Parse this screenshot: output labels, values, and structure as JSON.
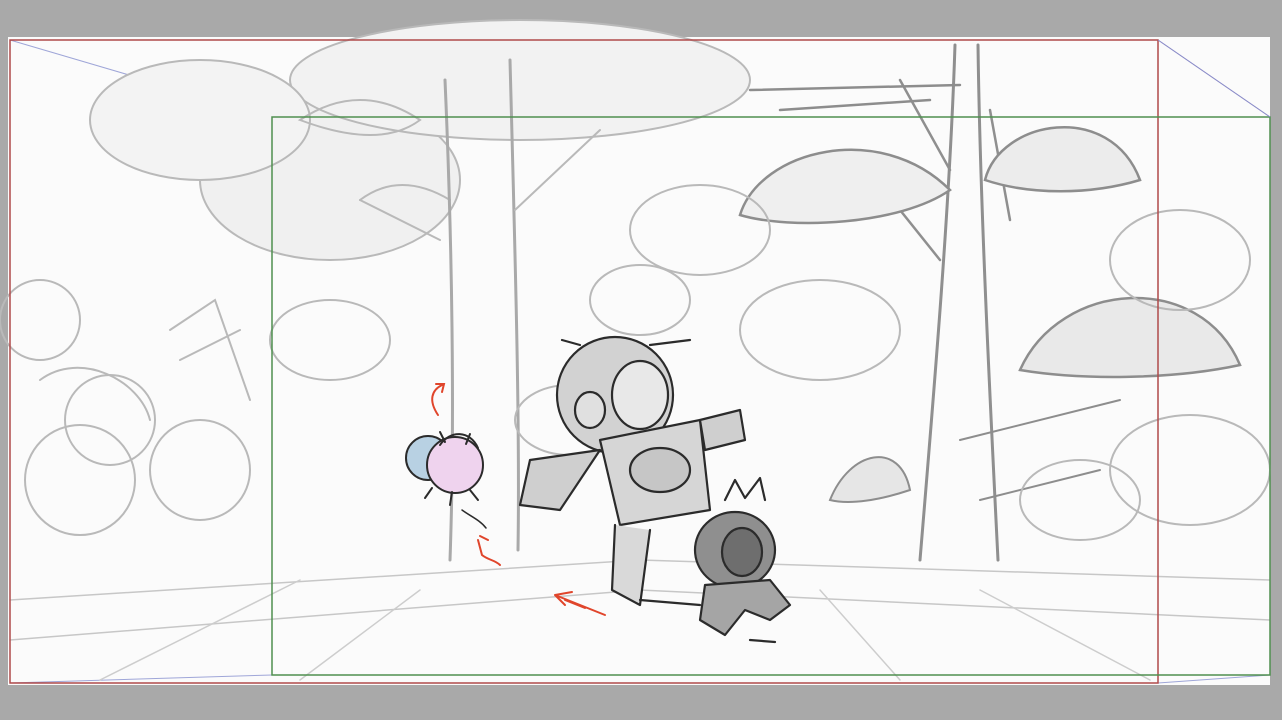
{
  "app": {
    "view": "storyboard-camera-frames"
  },
  "frames": {
    "start_frame_color": "#b04a4a",
    "end_frame_color": "#4f8f4f"
  },
  "colors": {
    "viewport_background": "#a9a9a9",
    "canvas_background": "#fbfbfb",
    "sketch_line": "#9a9a9a",
    "character_ink": "#2b2b2b",
    "annotation_red": "#e0452b"
  }
}
